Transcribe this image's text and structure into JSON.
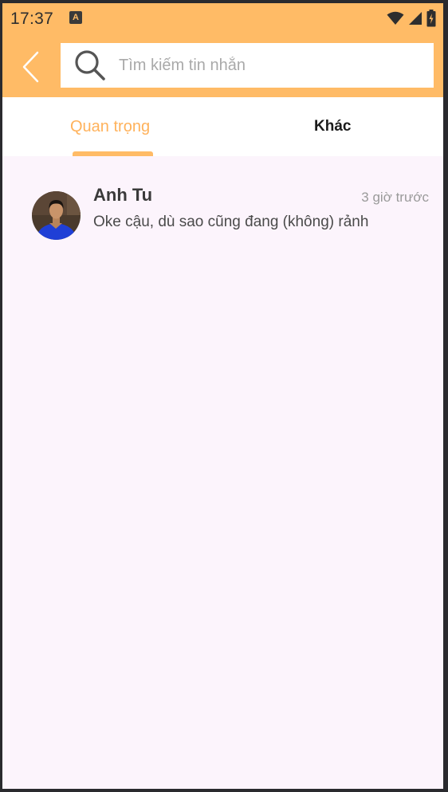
{
  "status_bar": {
    "time": "17:37",
    "notification_glyph": "A",
    "icons": [
      "wifi-icon",
      "signal-icon",
      "battery-charging-icon"
    ]
  },
  "app_bar": {
    "back_icon": "chevron-left-icon",
    "search": {
      "icon": "search-icon",
      "placeholder": "Tìm kiếm tin nhắn",
      "value": ""
    }
  },
  "tabs": [
    {
      "label": "Quan trọng",
      "active": true
    },
    {
      "label": "Khác",
      "active": false
    }
  ],
  "conversations": [
    {
      "name": "Anh Tu",
      "time": "3 giờ trước",
      "preview": "Oke cậu, dù sao cũng đang (không) rảnh",
      "avatar": "avatar-photo"
    }
  ],
  "colors": {
    "accent": "#ffbb66",
    "tab_active_text": "#ffb25b",
    "background": "#fcf4fc"
  }
}
